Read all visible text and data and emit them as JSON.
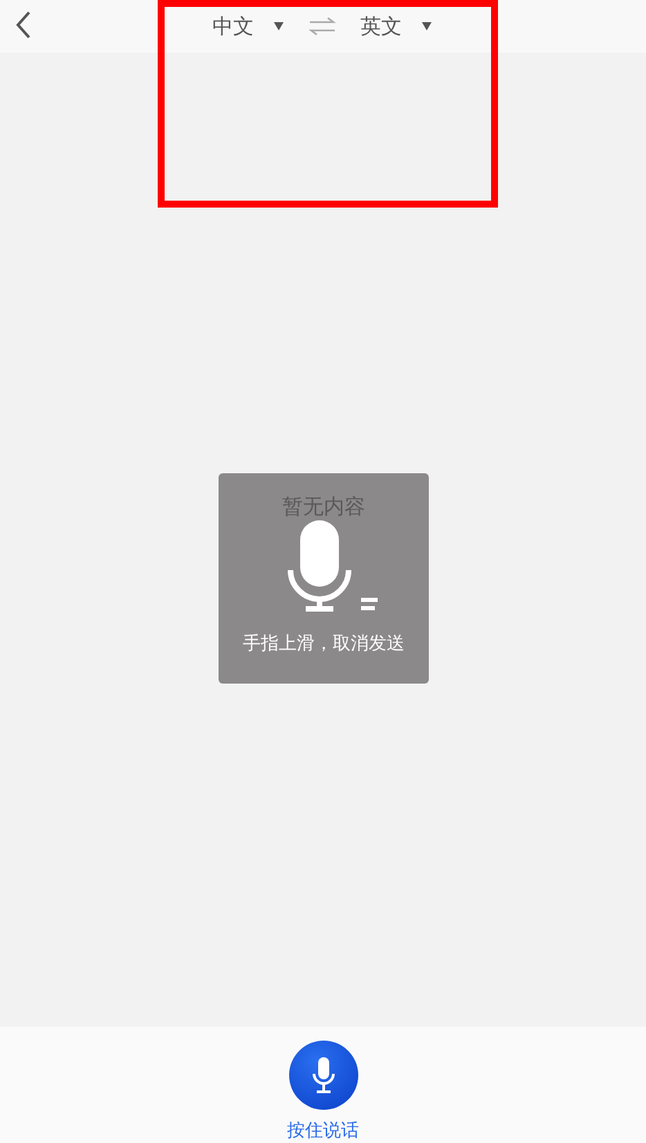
{
  "header": {
    "source_language": "中文",
    "target_language": "英文"
  },
  "empty_state": {
    "text": "暂无内容"
  },
  "recording_overlay": {
    "hint": "手指上滑，取消发送"
  },
  "talk_button": {
    "label": "按住说话"
  }
}
